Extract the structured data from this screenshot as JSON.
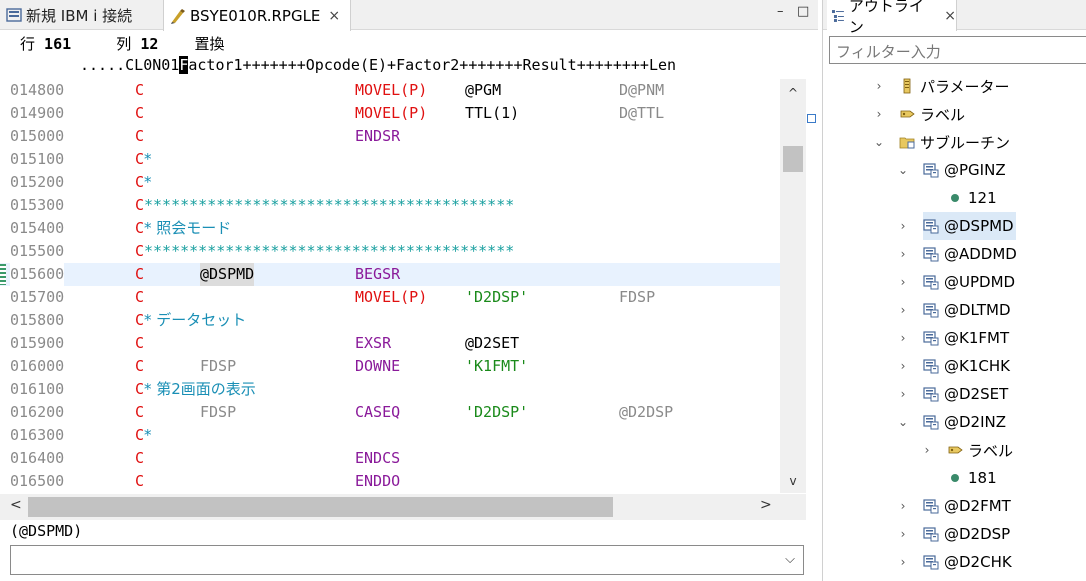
{
  "editor_tabs": [
    {
      "label": "新規 IBM i 接続"
    },
    {
      "label": "BSYE010R.RPGLE",
      "close": "×"
    }
  ],
  "window_controls": {
    "minimize": "–",
    "maximize": "□"
  },
  "status": {
    "row_label": "行",
    "row": "161",
    "col_label": "列",
    "col": "12",
    "mode": "置換"
  },
  "ruler": {
    "prefix": ".....CL0N01",
    "cursor_char": "F",
    "rest": "actor1+++++++Opcode(E)+Factor2+++++++Result++++++++Len"
  },
  "lines": [
    {
      "seq": "014800",
      "c": "C",
      "op": "MOVEL(P)",
      "f2": "@PGM",
      "res": "D@PNM"
    },
    {
      "seq": "014900",
      "c": "C",
      "op": "MOVEL(P)",
      "f2": "TTL(1)",
      "res": "D@TTL"
    },
    {
      "seq": "015000",
      "c": "C",
      "op": "ENDSR"
    },
    {
      "seq": "015100",
      "c": "C",
      "cmt": "*"
    },
    {
      "seq": "015200",
      "c": "C",
      "cmt": "*"
    },
    {
      "seq": "015300",
      "c": "C",
      "stars": "*****************************************"
    },
    {
      "seq": "015400",
      "c": "C",
      "cmt": "* 照会モード"
    },
    {
      "seq": "015500",
      "c": "C",
      "stars": "*****************************************"
    },
    {
      "seq": "015600",
      "c": "C",
      "f1": "@DSPMD",
      "op": "BEGSR"
    },
    {
      "seq": "015700",
      "c": "C",
      "op": "MOVEL(P)",
      "f2": "'D2DSP'",
      "res": "FDSP"
    },
    {
      "seq": "015800",
      "c": "C",
      "cmt": "* データセット"
    },
    {
      "seq": "015900",
      "c": "C",
      "op": "EXSR",
      "f2": "@D2SET"
    },
    {
      "seq": "016000",
      "c": "C",
      "f1": "FDSP",
      "op": "DOWNE",
      "f2": "'K1FMT'"
    },
    {
      "seq": "016100",
      "c": "C",
      "cmt": "* 第2画面の表示"
    },
    {
      "seq": "016200",
      "c": "C",
      "f1": "FDSP",
      "op": "CASEQ",
      "f2": "'D2DSP'",
      "res": "@D2DSP"
    },
    {
      "seq": "016300",
      "c": "C",
      "cmt": "*"
    },
    {
      "seq": "016400",
      "c": "C",
      "op": "ENDCS"
    },
    {
      "seq": "016500",
      "c": "C",
      "op": "ENDDO"
    }
  ],
  "scroll": {
    "up": "^",
    "down": "v",
    "left": "<",
    "right": ">"
  },
  "context_label": "(@DSPMD)",
  "combo_arrow": "⌵",
  "outline": {
    "title": "アウトライン",
    "close": "×",
    "filter_placeholder": "フィルター入力",
    "nodes": [
      {
        "label": "パラメーター",
        "level": 1,
        "twisty": "›",
        "icon": "parameter-icon"
      },
      {
        "label": "ラベル",
        "level": 1,
        "twisty": "›",
        "icon": "label-icon"
      },
      {
        "label": "サブルーチン",
        "level": 1,
        "twisty": "⌄",
        "icon": "folder-icon"
      },
      {
        "label": "@PGINZ",
        "level": 2,
        "twisty": "⌄",
        "icon": "subroutine-icon"
      },
      {
        "label": "121",
        "level": 3,
        "twisty": "",
        "icon": "line-number-icon"
      },
      {
        "label": "@DSPMD",
        "level": 2,
        "twisty": "›",
        "icon": "subroutine-icon",
        "selected": true
      },
      {
        "label": "@ADDMD",
        "level": 2,
        "twisty": "›",
        "icon": "subroutine-icon"
      },
      {
        "label": "@UPDMD",
        "level": 2,
        "twisty": "›",
        "icon": "subroutine-icon"
      },
      {
        "label": "@DLTMD",
        "level": 2,
        "twisty": "›",
        "icon": "subroutine-icon"
      },
      {
        "label": "@K1FMT",
        "level": 2,
        "twisty": "›",
        "icon": "subroutine-icon"
      },
      {
        "label": "@K1CHK",
        "level": 2,
        "twisty": "›",
        "icon": "subroutine-icon"
      },
      {
        "label": "@D2SET",
        "level": 2,
        "twisty": "›",
        "icon": "subroutine-icon"
      },
      {
        "label": "@D2INZ",
        "level": 2,
        "twisty": "⌄",
        "icon": "subroutine-icon"
      },
      {
        "label": "ラベル",
        "level": 3,
        "twisty": "›",
        "icon": "label-icon"
      },
      {
        "label": "181",
        "level": 3,
        "twisty": "",
        "icon": "line-number-icon"
      },
      {
        "label": "@D2FMT",
        "level": 2,
        "twisty": "›",
        "icon": "subroutine-icon"
      },
      {
        "label": "@D2DSP",
        "level": 2,
        "twisty": "›",
        "icon": "subroutine-icon"
      },
      {
        "label": "@D2CHK",
        "level": 2,
        "twisty": "›",
        "icon": "subroutine-icon"
      }
    ]
  },
  "colors": {
    "fixed_c": "#e01010",
    "opcode": "#8a1a9a",
    "literal": "#1a8a1a",
    "comment": "#1a8fb5",
    "stars": "#1aa0a0",
    "sequence": "#8a8a8a",
    "selection": "#dbe9f7"
  }
}
